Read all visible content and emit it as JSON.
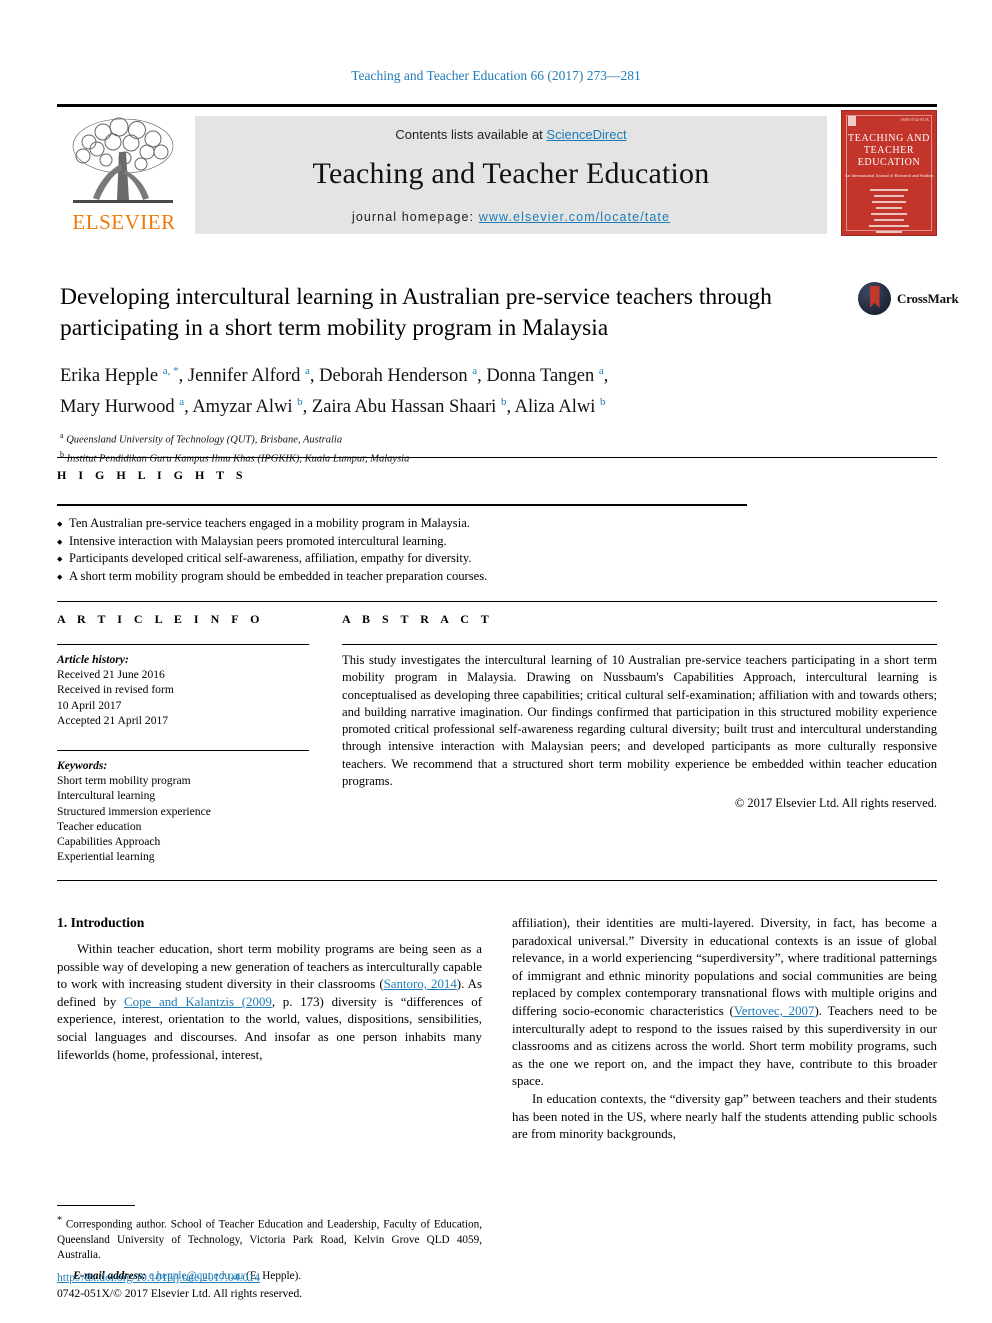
{
  "running_head": "Teaching and Teacher Education 66 (2017) 273—281",
  "masthead": {
    "contents_prefix": "Contents lists available at ",
    "sciencedirect": "ScienceDirect",
    "journal_name": "Teaching and Teacher Education",
    "homepage_prefix": "journal homepage: ",
    "homepage_url": "www.elsevier.com/locate/tate",
    "publisher": "ELSEVIER",
    "cover": {
      "title": "TEACHING AND TEACHER EDUCATION",
      "subtitle": "An International Journal of Research and Studies",
      "code": "ISSN 0742-051X"
    },
    "band_color": "#e4e4e4",
    "link_color": "#1f7bb6",
    "elsevier_orange": "#ec7a08"
  },
  "article": {
    "title": "Developing intercultural learning in Australian pre-service teachers through participating in a short term mobility program in Malaysia",
    "crossmark_label": "CrossMark",
    "authors_line1": "Erika Hepple a, *, Jennifer Alford a, Deborah Henderson a, Donna Tangen a,",
    "authors_line2": "Mary Hurwood a, Amyzar Alwi b, Zaira Abu Hassan Shaari b, Aliza Alwi b",
    "authors": [
      {
        "name": "Erika Hepple",
        "marks": "a, *"
      },
      {
        "name": "Jennifer Alford",
        "marks": "a"
      },
      {
        "name": "Deborah Henderson",
        "marks": "a"
      },
      {
        "name": "Donna Tangen",
        "marks": "a"
      },
      {
        "name": "Mary Hurwood",
        "marks": "a"
      },
      {
        "name": "Amyzar Alwi",
        "marks": "b"
      },
      {
        "name": "Zaira Abu Hassan Shaari",
        "marks": "b"
      },
      {
        "name": "Aliza Alwi",
        "marks": "b"
      }
    ],
    "affiliations": [
      {
        "mark": "a",
        "text": "Queensland University of Technology (QUT), Brisbane, Australia"
      },
      {
        "mark": "b",
        "text": "Institut Pendidikan Guru Kampus Ilmu Khas (IPGKIK), Kuala Lumpur, Malaysia"
      }
    ]
  },
  "highlights": {
    "label": "H I G H L I G H T S",
    "items": [
      "Ten Australian pre-service teachers engaged in a mobility program in Malaysia.",
      "Intensive interaction with Malaysian peers promoted intercultural learning.",
      "Participants developed critical self-awareness, affiliation, empathy for diversity.",
      "A short term mobility program should be embedded in teacher preparation courses."
    ]
  },
  "article_info": {
    "label": "A R T I C L E  I N F O",
    "history_label": "Article history:",
    "history": [
      "Received 21 June 2016",
      "Received in revised form",
      "10 April 2017",
      "Accepted 21 April 2017"
    ],
    "keywords_label": "Keywords:",
    "keywords": [
      "Short term mobility program",
      "Intercultural learning",
      "Structured immersion experience",
      "Teacher education",
      "Capabilities Approach",
      "Experiential learning"
    ]
  },
  "abstract": {
    "label": "A B S T R A C T",
    "text": "This study investigates the intercultural learning of 10 Australian pre-service teachers participating in a short term mobility program in Malaysia. Drawing on Nussbaum's Capabilities Approach, intercultural learning is conceptualised as developing three capabilities; critical cultural self-examination; affiliation with and towards others; and building narrative imagination. Our findings confirmed that participation in this structured mobility experience promoted critical professional self-awareness regarding cultural diversity; built trust and intercultural understanding through intensive interaction with Malaysian peers; and developed participants as more culturally responsive teachers. We recommend that a structured short term mobility experience be embedded within teacher education programs.",
    "copyright": "© 2017 Elsevier Ltd. All rights reserved."
  },
  "body": {
    "section_heading": "1. Introduction",
    "left_paragraph_parts": {
      "p1_a": "Within teacher education, short term mobility programs are being seen as a possible way of developing a new generation of teachers as interculturally capable to work with increasing student diversity in their classrooms (",
      "p1_cite1": "Santoro, 2014",
      "p1_b": "). As defined by ",
      "p1_cite2": "Cope and Kalantzis (2009",
      "p1_c": ", p. 173) diversity is “differences of experience, interest, orientation to the world, values, dispositions, sensibilities, social languages and discourses. And insofar as one person inhabits many lifeworlds (home, professional, interest,"
    },
    "right_paragraph_parts": {
      "p2_a": "affiliation), their identities are multi-layered. Diversity, in fact, has become a paradoxical universal.” Diversity in educational contexts is an issue of global relevance, in a world experiencing “superdiversity”, where traditional patternings of immigrant and ethnic minority populations and social communities are being replaced by complex contemporary transnational flows with multiple origins and differing socio-economic characteristics (",
      "p2_cite1": "Vertovec, 2007",
      "p2_b": "). Teachers need to be interculturally adept to respond to the issues raised by this superdiversity in our classrooms and as citizens across the world. Short term mobility programs, such as the one we report on, and the impact they have, contribute to this broader space.",
      "p3": "In education contexts, the “diversity gap” between teachers and their students has been noted in the US, where nearly half the students attending public schools are from minority backgrounds,"
    }
  },
  "footnote": {
    "marker": "*",
    "text": "Corresponding author. School of Teacher Education and Leadership, Faculty of Education, Queensland University of Technology, Victoria Park Road, Kelvin Grove QLD 4059, Australia.",
    "email_label": "E-mail address:",
    "email": "e.hepple@qut.edu.au",
    "email_owner": "(E. Hepple)."
  },
  "footer": {
    "doi": "http://dx.doi.org/10.1016/j.tate.2017.04.014",
    "issn_line": "0742-051X/© 2017 Elsevier Ltd. All rights reserved."
  }
}
